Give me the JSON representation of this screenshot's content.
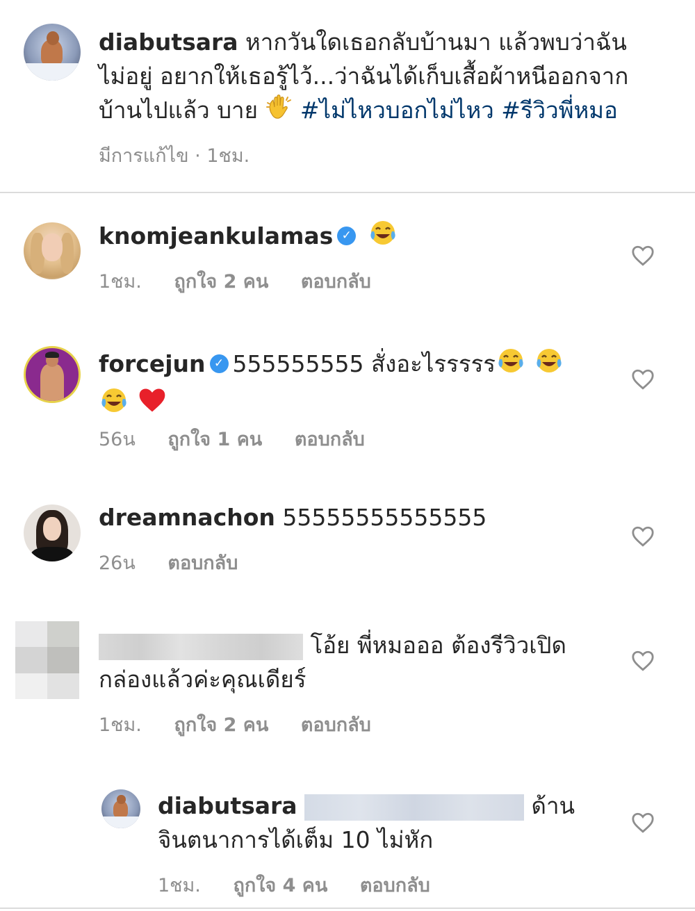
{
  "caption": {
    "username": "diabutsara",
    "line1": "หากวันใดเธอกลับบ้านมา แล้วพบว่าฉัน",
    "line2": "ไม่อยู่ อยากให้เธอรู้ไว้...ว่าฉันได้เก็บเสื้อผ้าหนีออกจาก",
    "line3": "บ้านไปแล้ว บาย",
    "hashtag1": "#ไม่ไหวบอกไม่ไหว",
    "hashtag2": "#รีวิวพี่หมอ",
    "edited": "มีการแก้ไข · 1ชม."
  },
  "comments": [
    {
      "username": "knomjeankulamas",
      "verified": true,
      "text": "",
      "time": "1ชม.",
      "likes": "ถูกใจ 2 คน",
      "reply": "ตอบกลับ"
    },
    {
      "username": "forcejun",
      "verified": true,
      "text": "555555555 สั่งอะไรรรรร",
      "time": "56น",
      "likes": "ถูกใจ 1 คน",
      "reply": "ตอบกลับ"
    },
    {
      "username": "dreamnachon",
      "verified": false,
      "text": "55555555555555",
      "time": "26น",
      "likes": "",
      "reply": "ตอบกลับ"
    },
    {
      "username": "",
      "verified": false,
      "text_line1": "โอ้ย พี่หมอออ ต้องรีวิวเปิด",
      "text_line2": "กล่องแล้วค่ะคุณเดียร์",
      "time": "1ชม.",
      "likes": "ถูกใจ 2 คน",
      "reply": "ตอบกลับ"
    }
  ],
  "reply": {
    "username": "diabutsara",
    "text_line1_end": "ด้าน",
    "text_line2": "จินตนาการได้เต็ม 10 ไม่หัก",
    "time": "1ชม.",
    "likes": "ถูกใจ 4 คน",
    "reply": "ตอบกลับ"
  },
  "colors": {
    "text": "#262626",
    "muted": "#8e8e8e",
    "hashtag": "#00376b",
    "verified": "#3897f0",
    "divider": "#dbdbdb"
  },
  "icons": {
    "like": "heart-outline-icon",
    "verified": "verified-badge-icon"
  }
}
